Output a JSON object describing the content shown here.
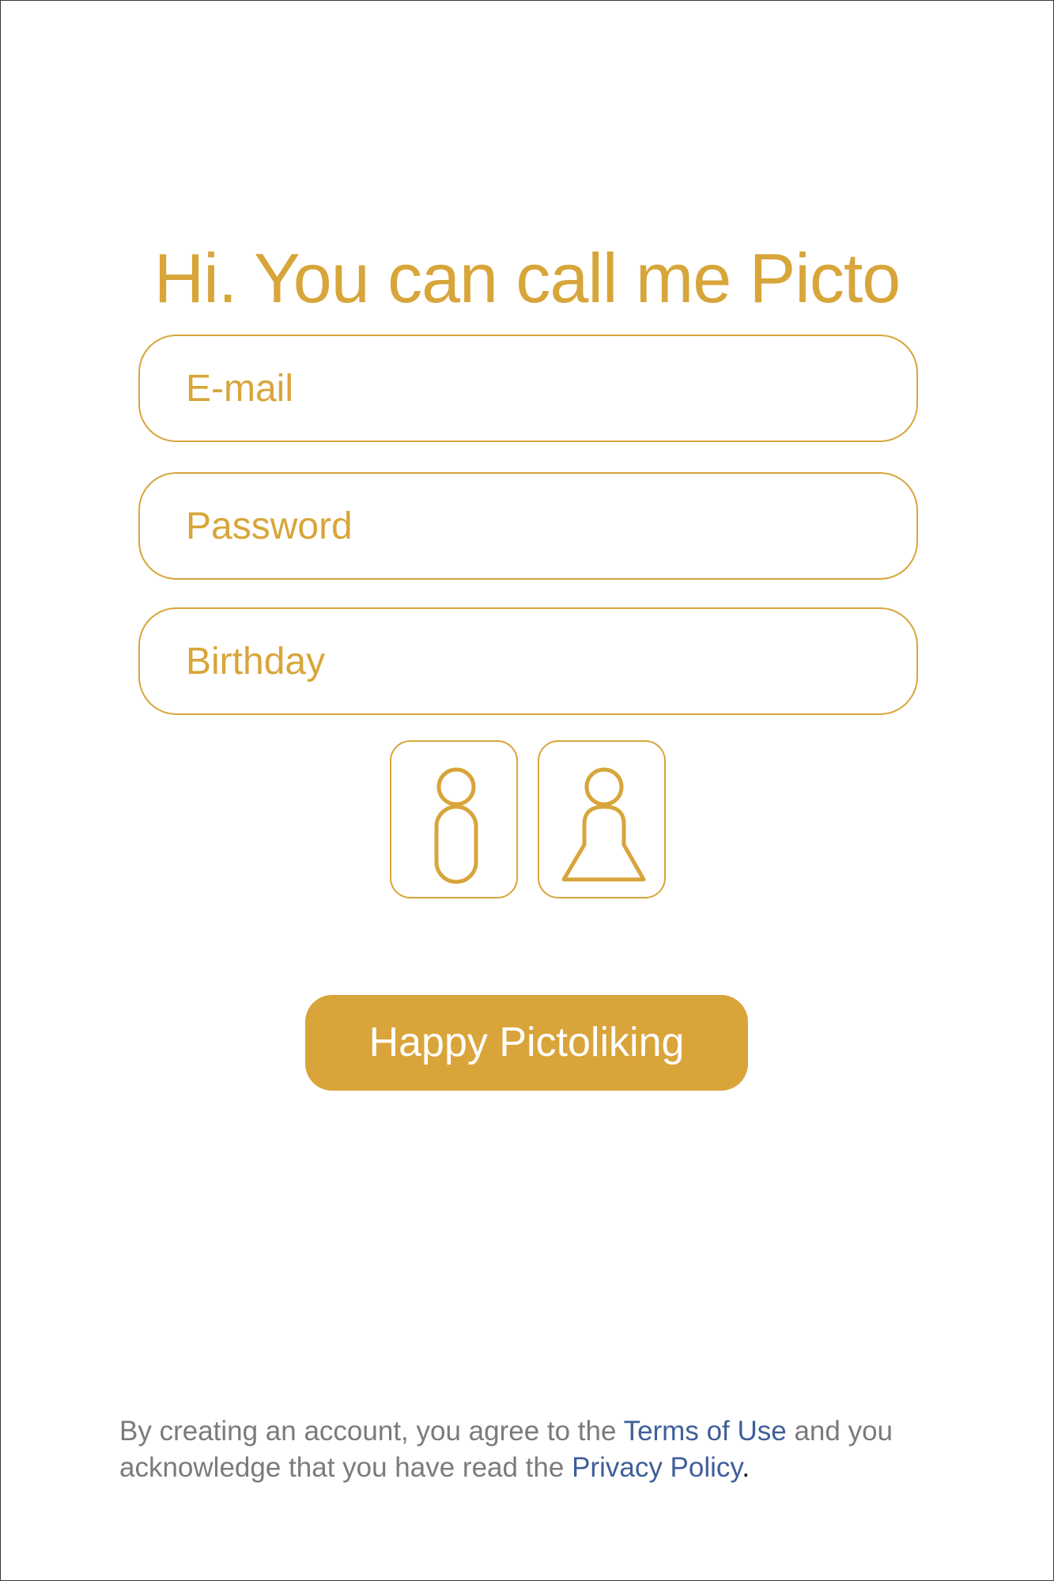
{
  "header": {
    "title": "Hi. You can call me Picto"
  },
  "form": {
    "email_placeholder": "E-mail",
    "password_placeholder": "Password",
    "birthday_placeholder": "Birthday"
  },
  "gender": {
    "options": [
      {
        "icon": "male-figure-icon"
      },
      {
        "icon": "female-figure-icon"
      }
    ]
  },
  "actions": {
    "submit_label": "Happy Pictoliking"
  },
  "legal": {
    "text_part1": "By creating an account, you agree to the ",
    "terms_link": "Terms of Use",
    "text_part2": " and you acknowledge that you have read the ",
    "privacy_link": "Privacy Policy",
    "text_end": "."
  },
  "colors": {
    "accent": "#d8a53a",
    "button_fill": "#d9a43a",
    "link": "#3f5f9a",
    "legal_text": "#7b7b7b"
  }
}
